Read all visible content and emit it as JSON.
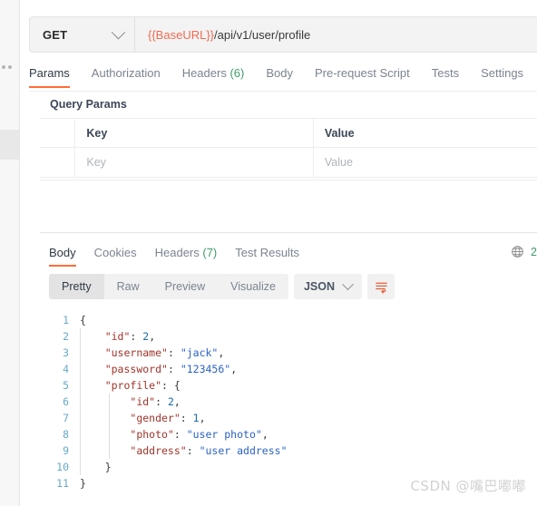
{
  "request": {
    "method": "GET",
    "method_chevron_icon": "chevron-down-icon",
    "url_variable": "{{BaseURL}}",
    "url_path": "/api/v1/user/profile",
    "tabs": [
      {
        "label": "Params",
        "active": true
      },
      {
        "label": "Authorization",
        "active": false
      },
      {
        "label": "Headers",
        "count": "(6)",
        "active": false
      },
      {
        "label": "Body",
        "active": false
      },
      {
        "label": "Pre-request Script",
        "active": false
      },
      {
        "label": "Tests",
        "active": false
      },
      {
        "label": "Settings",
        "active": false
      }
    ]
  },
  "query_params": {
    "title": "Query Params",
    "columns": [
      "Key",
      "Value"
    ],
    "rows": [
      {
        "key_placeholder": "Key",
        "value_placeholder": "Value"
      }
    ]
  },
  "response": {
    "tabs": [
      {
        "label": "Body",
        "active": true
      },
      {
        "label": "Cookies",
        "active": false
      },
      {
        "label": "Headers",
        "count": "(7)",
        "active": false
      },
      {
        "label": "Test Results",
        "active": false
      }
    ],
    "globe_icon": "globe-icon",
    "status_code": "2",
    "view_modes": [
      {
        "label": "Pretty",
        "active": true
      },
      {
        "label": "Raw",
        "active": false
      },
      {
        "label": "Preview",
        "active": false
      },
      {
        "label": "Visualize",
        "active": false
      }
    ],
    "format": "JSON",
    "format_chevron_icon": "chevron-down-icon",
    "wrap_icon": "wrap-text-icon",
    "code": {
      "lines": [
        {
          "n": "1",
          "indent": 0,
          "guides": 0,
          "tokens": [
            {
              "t": "{",
              "c": "jpun"
            }
          ]
        },
        {
          "n": "2",
          "indent": 1,
          "guides": 1,
          "tokens": [
            {
              "t": "\"id\"",
              "c": "jkey"
            },
            {
              "t": ": ",
              "c": "jpun"
            },
            {
              "t": "2",
              "c": "jnum"
            },
            {
              "t": ",",
              "c": "jpun"
            }
          ]
        },
        {
          "n": "3",
          "indent": 1,
          "guides": 1,
          "tokens": [
            {
              "t": "\"username\"",
              "c": "jkey"
            },
            {
              "t": ": ",
              "c": "jpun"
            },
            {
              "t": "\"jack\"",
              "c": "jstr"
            },
            {
              "t": ",",
              "c": "jpun"
            }
          ]
        },
        {
          "n": "4",
          "indent": 1,
          "guides": 1,
          "tokens": [
            {
              "t": "\"password\"",
              "c": "jkey"
            },
            {
              "t": ": ",
              "c": "jpun"
            },
            {
              "t": "\"123456\"",
              "c": "jstr"
            },
            {
              "t": ",",
              "c": "jpun"
            }
          ]
        },
        {
          "n": "5",
          "indent": 1,
          "guides": 1,
          "tokens": [
            {
              "t": "\"profile\"",
              "c": "jkey"
            },
            {
              "t": ": {",
              "c": "jpun"
            }
          ]
        },
        {
          "n": "6",
          "indent": 2,
          "guides": 2,
          "tokens": [
            {
              "t": "\"id\"",
              "c": "jkey"
            },
            {
              "t": ": ",
              "c": "jpun"
            },
            {
              "t": "2",
              "c": "jnum"
            },
            {
              "t": ",",
              "c": "jpun"
            }
          ]
        },
        {
          "n": "7",
          "indent": 2,
          "guides": 2,
          "tokens": [
            {
              "t": "\"gender\"",
              "c": "jkey"
            },
            {
              "t": ": ",
              "c": "jpun"
            },
            {
              "t": "1",
              "c": "jnum"
            },
            {
              "t": ",",
              "c": "jpun"
            }
          ]
        },
        {
          "n": "8",
          "indent": 2,
          "guides": 2,
          "tokens": [
            {
              "t": "\"photo\"",
              "c": "jkey"
            },
            {
              "t": ": ",
              "c": "jpun"
            },
            {
              "t": "\"user photo\"",
              "c": "jstr"
            },
            {
              "t": ",",
              "c": "jpun"
            }
          ]
        },
        {
          "n": "9",
          "indent": 2,
          "guides": 2,
          "tokens": [
            {
              "t": "\"address\"",
              "c": "jkey"
            },
            {
              "t": ": ",
              "c": "jpun"
            },
            {
              "t": "\"user address\"",
              "c": "jstr"
            }
          ]
        },
        {
          "n": "10",
          "indent": 1,
          "guides": 1,
          "tokens": [
            {
              "t": "}",
              "c": "jpun"
            }
          ]
        },
        {
          "n": "11",
          "indent": 0,
          "guides": 0,
          "tokens": [
            {
              "t": "}",
              "c": "jpun"
            }
          ]
        }
      ]
    }
  },
  "watermark": "CSDN @嘴巴嘟嘟",
  "colors": {
    "accent": "#ff6c37",
    "variable": "#ef6b53",
    "count_green": "#3f9d6a",
    "json_key": "#a0342a",
    "json_string": "#2a62c4",
    "line_number": "#67a9c9"
  }
}
